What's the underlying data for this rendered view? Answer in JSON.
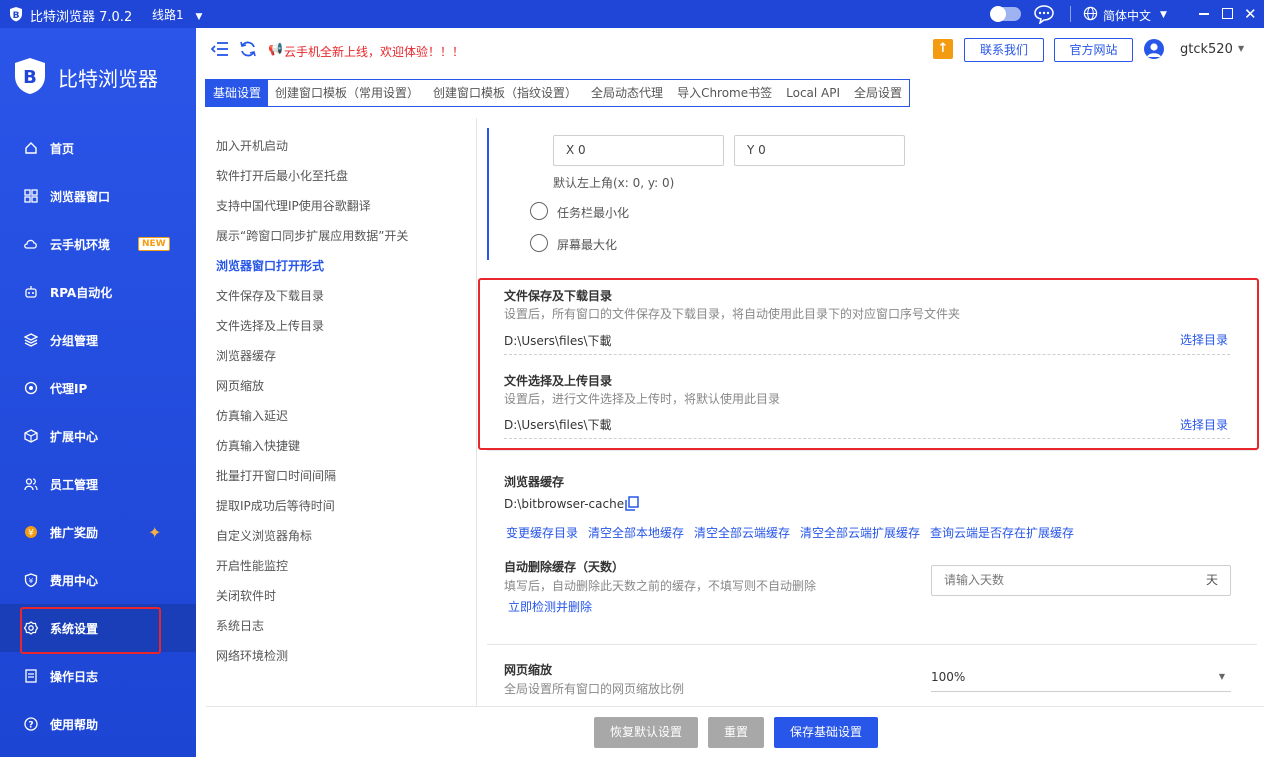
{
  "titlebar": {
    "app_title": "比特浏览器 7.0.2",
    "line": "线路1",
    "language": "简体中文"
  },
  "brand": {
    "name": "比特浏览器"
  },
  "sidebar": {
    "items": [
      {
        "label": "首页",
        "icon": "home-icon"
      },
      {
        "label": "浏览器窗口",
        "icon": "grid-icon"
      },
      {
        "label": "云手机环境",
        "icon": "cloud-icon",
        "badge": "NEW"
      },
      {
        "label": "RPA自动化",
        "icon": "rpa-icon"
      },
      {
        "label": "分组管理",
        "icon": "layers-icon"
      },
      {
        "label": "代理IP",
        "icon": "location-icon"
      },
      {
        "label": "扩展中心",
        "icon": "box-icon"
      },
      {
        "label": "员工管理",
        "icon": "users-icon"
      },
      {
        "label": "推广奖励",
        "icon": "gift-icon"
      },
      {
        "label": "费用中心",
        "icon": "shield-icon"
      },
      {
        "label": "系统设置",
        "icon": "gear-icon"
      },
      {
        "label": "操作日志",
        "icon": "log-icon"
      },
      {
        "label": "使用帮助",
        "icon": "help-icon"
      }
    ],
    "active_index": 10
  },
  "topbar": {
    "announcement": "云手机全新上线，欢迎体验！！！",
    "contact_label": "联系我们",
    "website_label": "官方网站",
    "username": "gtck520"
  },
  "tabs": [
    {
      "label": "基础设置",
      "active": true
    },
    {
      "label": "创建窗口模板（常用设置）",
      "active": false
    },
    {
      "label": "创建窗口模板（指纹设置）",
      "active": false
    },
    {
      "label": "全局动态代理",
      "active": false
    },
    {
      "label": "导入Chrome书签",
      "active": false
    },
    {
      "label": "Local API",
      "active": false
    },
    {
      "label": "全局设置",
      "active": false
    }
  ],
  "left_menu": [
    "加入开机启动",
    "软件打开后最小化至托盘",
    "支持中国代理IP使用谷歌翻译",
    "展示“跨窗口同步扩展应用数据”开关",
    "浏览器窗口打开形式",
    "文件保存及下载目录",
    "文件选择及上传目录",
    "浏览器缓存",
    "网页缩放",
    "仿真输入延迟",
    "仿真输入快捷键",
    "批量打开窗口时间间隔",
    "提取IP成功后等待时间",
    "自定义浏览器角标",
    "开启性能监控",
    "关闭软件时",
    "系统日志",
    "网络环境检测"
  ],
  "left_menu_active_index": 4,
  "window_position": {
    "x_value": "X  0",
    "y_value": "Y  0",
    "hint": "默认左上角(x: 0, y: 0)",
    "option_minimize": "任务栏最小化",
    "option_maximize": "屏幕最大化"
  },
  "download_dir": {
    "title": "文件保存及下载目录",
    "desc": "设置后，所有窗口的文件保存及下载目录，将自动使用此目录下的对应窗口序号文件夹",
    "path": "D:\\Users\\files\\下載",
    "choose_label": "选择目录"
  },
  "upload_dir": {
    "title": "文件选择及上传目录",
    "desc": "设置后，进行文件选择及上传时，将默认使用此目录",
    "path": "D:\\Users\\files\\下載",
    "choose_label": "选择目录"
  },
  "cache": {
    "title": "浏览器缓存",
    "path": "D:\\bitbrowser-cache",
    "links": [
      "变更缓存目录",
      "清空全部本地缓存",
      "清空全部云端缓存",
      "清空全部云端扩展缓存",
      "查询云端是否存在扩展缓存"
    ]
  },
  "auto_delete": {
    "title": "自动删除缓存（天数）",
    "desc": "填写后，自动删除此天数之前的缓存，不填写则不自动删除",
    "link": "立即检测并删除",
    "placeholder": "请输入天数",
    "suffix": "天"
  },
  "zoom": {
    "title": "网页缩放",
    "desc": "全局设置所有窗口的网页缩放比例",
    "value": "100%"
  },
  "bottom": {
    "restore_label": "恢复默认设置",
    "reset_label": "重置",
    "save_label": "保存基础设置"
  },
  "colors": {
    "brand_blue": "#2756e8",
    "sidebar_active": "#1a3eb8",
    "highlight_red": "#e8262b",
    "warning_orange": "#f39c12"
  }
}
